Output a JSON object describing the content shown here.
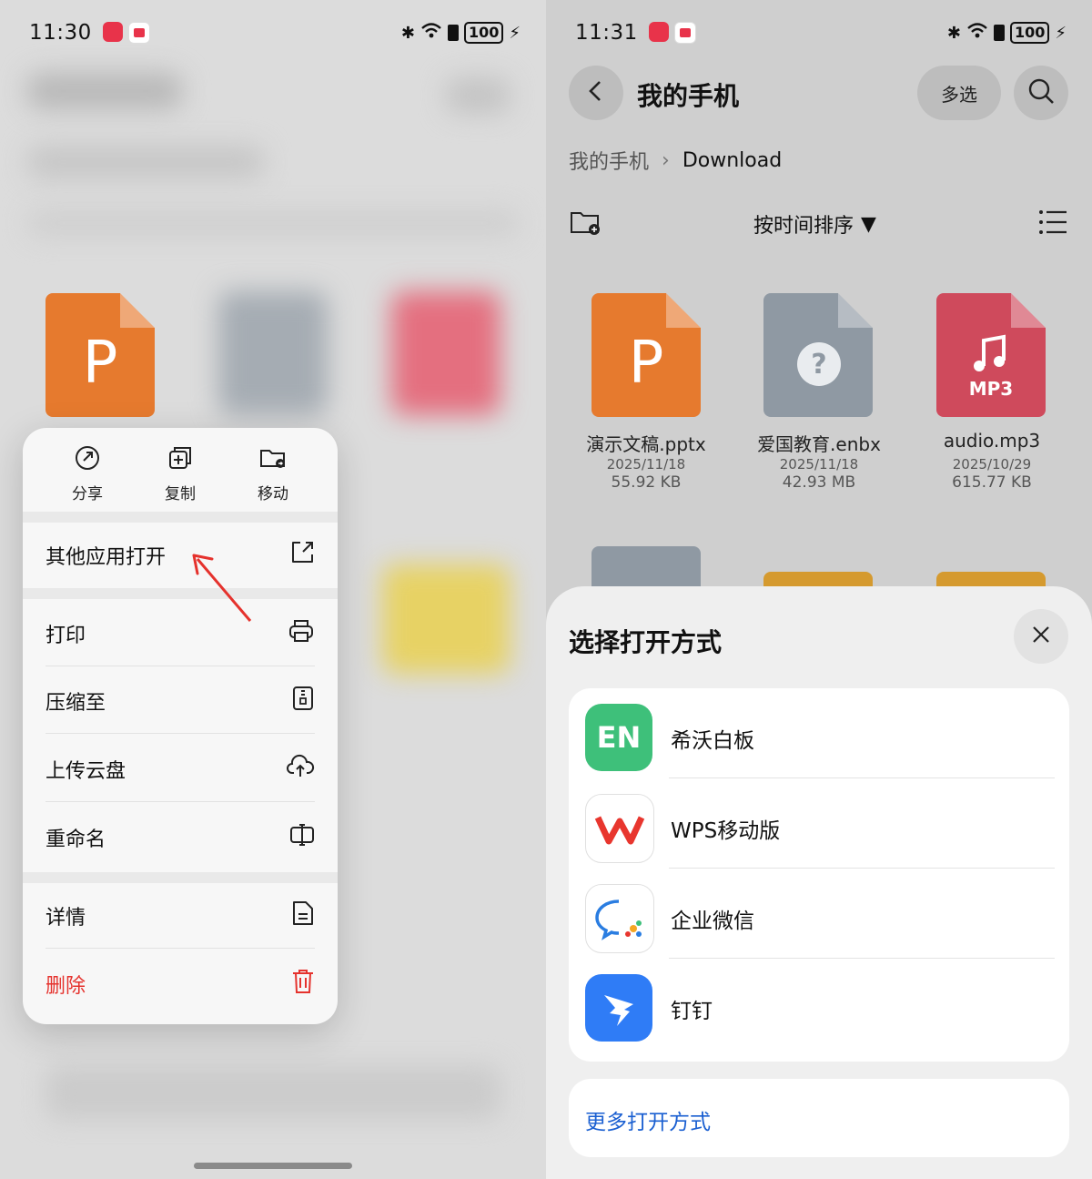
{
  "left": {
    "status": {
      "time": "11:30",
      "battery": "100"
    },
    "popup": {
      "quick_actions": [
        {
          "label": "分享",
          "icon": "share-icon"
        },
        {
          "label": "复制",
          "icon": "copy-icon"
        },
        {
          "label": "移动",
          "icon": "move-icon"
        }
      ],
      "menu": [
        {
          "label": "其他应用打开",
          "icon": "open-external-icon"
        },
        {
          "label": "打印",
          "icon": "printer-icon"
        },
        {
          "label": "压缩至",
          "icon": "compress-icon"
        },
        {
          "label": "上传云盘",
          "icon": "cloud-upload-icon"
        },
        {
          "label": "重命名",
          "icon": "rename-icon"
        },
        {
          "label": "详情",
          "icon": "details-icon"
        },
        {
          "label": "删除",
          "icon": "trash-icon"
        }
      ]
    }
  },
  "right": {
    "status": {
      "time": "11:31",
      "battery": "100"
    },
    "header": {
      "title": "我的手机",
      "multi_select": "多选"
    },
    "breadcrumb": {
      "root": "我的手机",
      "current": "Download"
    },
    "toolbar": {
      "sort_label": "按时间排序"
    },
    "files": [
      {
        "name": "演示文稿.pptx",
        "date": "2025/11/18",
        "size": "55.92 KB",
        "badge": "P",
        "color": "#e67a2e"
      },
      {
        "name": "爱国教育.enbx",
        "date": "2025/11/18",
        "size": "42.93 MB",
        "badge": "?",
        "color": "#8f99a3"
      },
      {
        "name": "audio.mp3",
        "date": "2025/10/29",
        "size": "615.77 KB",
        "badge": "MP3",
        "color": "#cf4a5c"
      }
    ],
    "sheet": {
      "title": "选择打开方式",
      "apps": [
        {
          "name": "希沃白板",
          "icon": "seewo-whiteboard-icon",
          "badge": "EN"
        },
        {
          "name": "WPS移动版",
          "icon": "wps-icon"
        },
        {
          "name": "企业微信",
          "icon": "wecom-icon"
        },
        {
          "name": "钉钉",
          "icon": "dingtalk-icon"
        }
      ],
      "more": "更多打开方式"
    }
  },
  "colors": {
    "accent_blue": "#1a5fd1",
    "danger_red": "#e5322d",
    "ppt_orange": "#e67a2e"
  }
}
